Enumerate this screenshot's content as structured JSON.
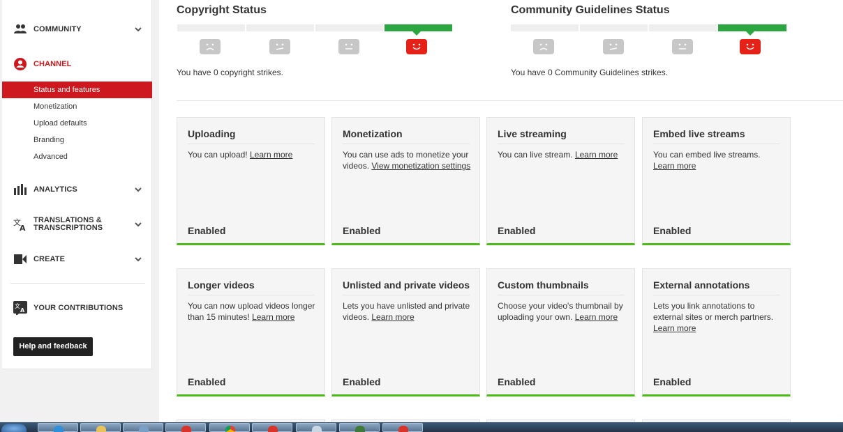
{
  "sidebar": {
    "community": "COMMUNITY",
    "channel": "CHANNEL",
    "sub_items": [
      "Status and features",
      "Monetization",
      "Upload defaults",
      "Branding",
      "Advanced"
    ],
    "analytics": "ANALYTICS",
    "translations_line1": "TRANSLATIONS &",
    "translations_line2": "TRANSCRIPTIONS",
    "create": "CREATE",
    "contributions": "YOUR CONTRIBUTIONS",
    "help_label": "Help and feedback"
  },
  "copyright": {
    "title": "Copyright Status",
    "strikes_text": "You have 0 copyright strikes."
  },
  "guidelines": {
    "title": "Community Guidelines Status",
    "strikes_text": "You have 0 Community Guidelines strikes."
  },
  "cards": [
    {
      "title": "Uploading",
      "desc": "You can upload! ",
      "link": "Learn more",
      "status": "Enabled"
    },
    {
      "title": "Monetization",
      "desc": "You can use ads to monetize your videos. ",
      "link": "View monetization settings",
      "status": "Enabled"
    },
    {
      "title": "Live streaming",
      "desc": "You can live stream. ",
      "link": "Learn more",
      "status": "Enabled"
    },
    {
      "title": "Embed live streams",
      "desc": "You can embed live streams. ",
      "link": "Learn more",
      "status": "Enabled"
    },
    {
      "title": "Longer videos",
      "desc": "You can now upload videos longer than 15 minutes! ",
      "link": "Learn more",
      "status": "Enabled"
    },
    {
      "title": "Unlisted and private videos",
      "desc": "Lets you have unlisted and private videos. ",
      "link": "Learn more",
      "status": "Enabled"
    },
    {
      "title": "Custom thumbnails",
      "desc": "Choose your video's thumbnail by uploading your own. ",
      "link": "Learn more",
      "status": "Enabled"
    },
    {
      "title": "External annotations",
      "desc": "Lets you link annotations to external sites or merch partners. ",
      "link": "Learn more",
      "status": "Enabled"
    }
  ],
  "colors": {
    "accent_red": "#cc181e",
    "status_green": "#2ba640",
    "enabled_border": "#4cbb17"
  }
}
